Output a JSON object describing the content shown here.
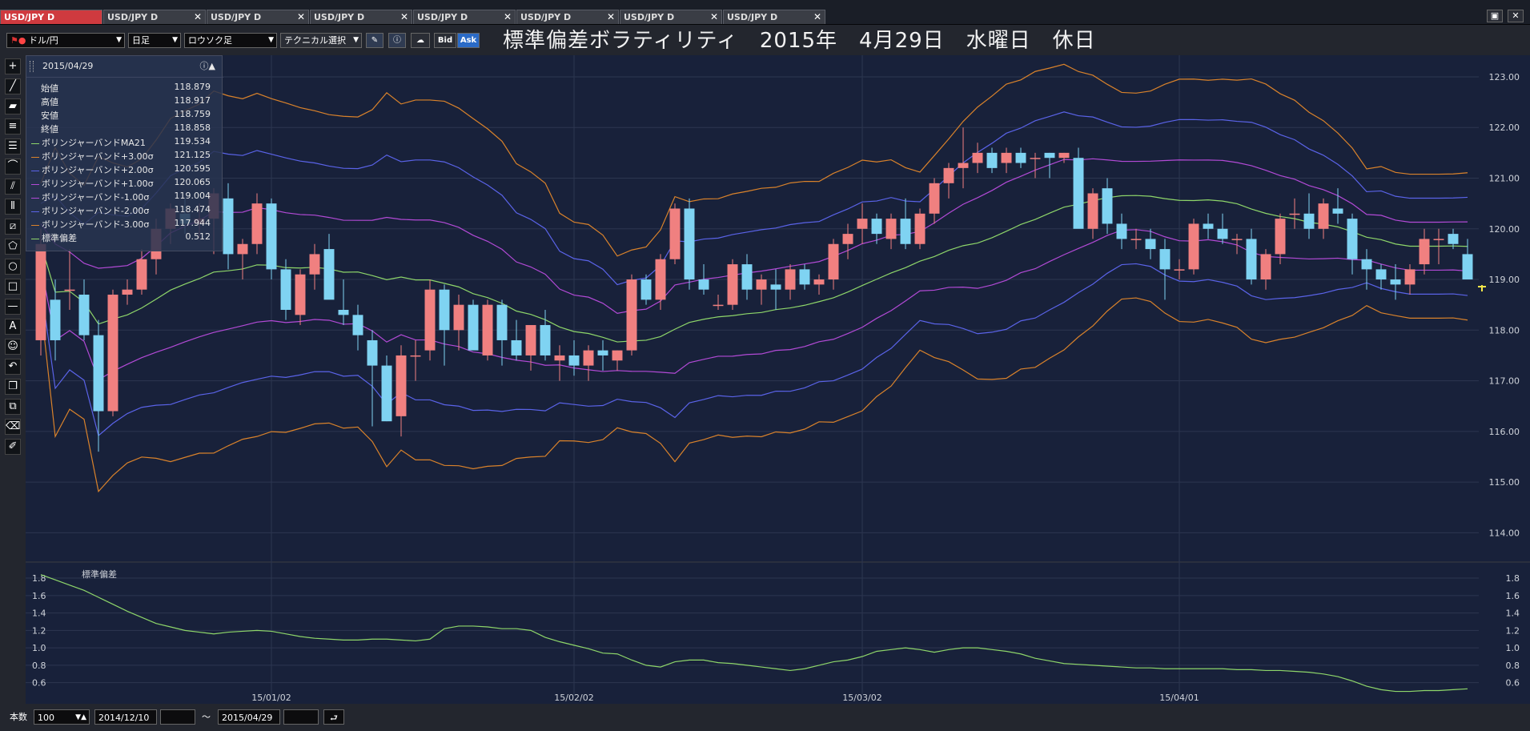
{
  "tabs": [
    {
      "label": "USD/JPY D",
      "active": true
    },
    {
      "label": "USD/JPY D",
      "active": false
    },
    {
      "label": "USD/JPY D",
      "active": false
    },
    {
      "label": "USD/JPY D",
      "active": false
    },
    {
      "label": "USD/JPY D",
      "active": false
    },
    {
      "label": "USD/JPY D",
      "active": false
    },
    {
      "label": "USD/JPY D",
      "active": false
    },
    {
      "label": "USD/JPY D",
      "active": false
    }
  ],
  "toolbar": {
    "currency": "ドル/円",
    "period": "日足",
    "chart_style": "ロウソク足",
    "technical": "テクニカル選択",
    "bid": "Bid",
    "ask": "Ask"
  },
  "title": "標準偏差ボラティリティ　2015年　4月29日　水曜日　休日",
  "info": {
    "date": "2015/04/29",
    "rows": [
      {
        "label": "始値",
        "value": "118.879"
      },
      {
        "label": "高値",
        "value": "118.917"
      },
      {
        "label": "安値",
        "value": "118.759"
      },
      {
        "label": "終値",
        "value": "118.858"
      },
      {
        "label": "ボリンジャーバンドMA21",
        "value": "119.534",
        "color": "#8ed66a"
      },
      {
        "label": "ボリンジャーバンド+3.00σ",
        "value": "121.125",
        "color": "#d9822b"
      },
      {
        "label": "ボリンジャーバンド+2.00σ",
        "value": "120.595",
        "color": "#5a63e8"
      },
      {
        "label": "ボリンジャーバンド+1.00σ",
        "value": "120.065",
        "color": "#b24ad6"
      },
      {
        "label": "ボリンジャーバンド-1.00σ",
        "value": "119.004",
        "color": "#b24ad6"
      },
      {
        "label": "ボリンジャーバンド-2.00σ",
        "value": "118.474",
        "color": "#5a63e8"
      },
      {
        "label": "ボリンジャーバンド-3.00σ",
        "value": "117.944",
        "color": "#d9822b"
      },
      {
        "label": "標準偏差",
        "value": "0.512",
        "color": "#8ed66a"
      }
    ]
  },
  "subpanel_label": "標準偏差",
  "status": {
    "count_label": "本数",
    "count_value": "100",
    "from_date": "2014/12/10",
    "tilde": "～",
    "to_date": "2015/04/29"
  },
  "colors": {
    "up": "#f08080",
    "down": "#7fd3f2",
    "ma": "#8ed66a",
    "s1": "#b24ad6",
    "s2": "#5a63e8",
    "s3": "#d9822b",
    "sd": "#8ed66a"
  },
  "chart_data": [
    {
      "type": "candlestick",
      "y_ticks": [
        "123.00",
        "122.00",
        "121.00",
        "120.00",
        "119.00",
        "118.00",
        "117.00",
        "116.00",
        "115.00",
        "114.00"
      ],
      "ylim": [
        113.5,
        123.3
      ],
      "x_ticks": [
        {
          "label": "15/01/02",
          "index": 16
        },
        {
          "label": "15/02/02",
          "index": 37
        },
        {
          "label": "15/03/02",
          "index": 57
        },
        {
          "label": "15/04/01",
          "index": 79
        }
      ],
      "n": 100,
      "candles": [
        [
          117.8,
          120.0,
          117.5,
          119.7
        ],
        [
          118.6,
          119.0,
          117.4,
          117.8
        ],
        [
          118.8,
          119.6,
          118.4,
          118.8
        ],
        [
          118.7,
          119.0,
          117.8,
          117.9
        ],
        [
          117.9,
          118.2,
          115.6,
          116.4
        ],
        [
          116.4,
          118.8,
          116.3,
          118.7
        ],
        [
          118.7,
          119.0,
          118.5,
          118.8
        ],
        [
          118.8,
          119.6,
          118.7,
          119.4
        ],
        [
          119.4,
          120.2,
          119.1,
          120.0
        ],
        [
          120.0,
          120.5,
          119.7,
          120.4
        ],
        [
          120.3,
          120.6,
          119.9,
          120.1
        ],
        [
          120.1,
          120.5,
          119.8,
          120.2
        ],
        [
          120.2,
          120.8,
          119.5,
          120.7
        ],
        [
          120.6,
          120.9,
          119.2,
          119.5
        ],
        [
          119.5,
          119.8,
          119.0,
          119.7
        ],
        [
          119.7,
          120.7,
          119.5,
          120.5
        ],
        [
          120.5,
          120.6,
          119.0,
          119.2
        ],
        [
          119.2,
          119.4,
          118.2,
          118.4
        ],
        [
          118.3,
          119.2,
          118.1,
          119.1
        ],
        [
          119.1,
          119.7,
          118.8,
          119.5
        ],
        [
          119.6,
          119.9,
          118.7,
          118.6
        ],
        [
          118.4,
          119.0,
          118.1,
          118.3
        ],
        [
          118.3,
          118.5,
          117.6,
          117.9
        ],
        [
          117.8,
          118.0,
          116.1,
          117.3
        ],
        [
          117.3,
          117.5,
          116.2,
          116.2
        ],
        [
          116.3,
          117.7,
          115.9,
          117.5
        ],
        [
          117.5,
          117.8,
          117.0,
          117.5
        ],
        [
          117.6,
          119.0,
          117.4,
          118.8
        ],
        [
          118.8,
          118.9,
          117.3,
          118.0
        ],
        [
          118.0,
          118.7,
          117.6,
          118.5
        ],
        [
          118.5,
          118.6,
          117.7,
          117.6
        ],
        [
          117.5,
          118.6,
          117.4,
          118.5
        ],
        [
          118.5,
          118.6,
          117.3,
          117.8
        ],
        [
          117.8,
          118.2,
          117.4,
          117.5
        ],
        [
          117.5,
          118.1,
          117.2,
          118.1
        ],
        [
          118.1,
          118.4,
          117.4,
          117.5
        ],
        [
          117.4,
          117.7,
          117.0,
          117.5
        ],
        [
          117.5,
          117.8,
          117.1,
          117.3
        ],
        [
          117.3,
          117.7,
          117.0,
          117.6
        ],
        [
          117.6,
          117.8,
          117.2,
          117.5
        ],
        [
          117.4,
          117.6,
          117.2,
          117.6
        ],
        [
          117.6,
          119.1,
          117.5,
          119.0
        ],
        [
          119.0,
          119.1,
          118.5,
          118.6
        ],
        [
          118.6,
          119.5,
          118.4,
          119.4
        ],
        [
          119.4,
          120.5,
          119.3,
          120.4
        ],
        [
          120.4,
          120.6,
          118.8,
          119.0
        ],
        [
          119.0,
          119.3,
          118.7,
          118.8
        ],
        [
          118.5,
          118.7,
          118.4,
          118.5
        ],
        [
          118.5,
          119.4,
          118.4,
          119.3
        ],
        [
          119.3,
          119.5,
          118.6,
          118.8
        ],
        [
          118.8,
          119.1,
          118.5,
          119.0
        ],
        [
          118.9,
          119.2,
          118.4,
          118.8
        ],
        [
          118.8,
          119.3,
          118.6,
          119.2
        ],
        [
          119.2,
          119.3,
          118.8,
          118.9
        ],
        [
          118.9,
          119.1,
          118.7,
          119.0
        ],
        [
          119.0,
          119.8,
          118.8,
          119.7
        ],
        [
          119.7,
          120.1,
          119.4,
          119.9
        ],
        [
          120.0,
          120.5,
          119.7,
          120.2
        ],
        [
          120.2,
          120.3,
          119.7,
          119.9
        ],
        [
          119.8,
          120.3,
          119.6,
          120.2
        ],
        [
          120.2,
          120.6,
          119.6,
          119.7
        ],
        [
          119.7,
          120.4,
          119.6,
          120.3
        ],
        [
          120.3,
          121.0,
          120.1,
          120.9
        ],
        [
          120.9,
          121.3,
          120.6,
          121.2
        ],
        [
          121.2,
          122.0,
          120.8,
          121.3
        ],
        [
          121.3,
          121.7,
          121.1,
          121.5
        ],
        [
          121.5,
          121.6,
          121.1,
          121.2
        ],
        [
          121.3,
          121.6,
          121.1,
          121.5
        ],
        [
          121.5,
          121.6,
          121.2,
          121.3
        ],
        [
          121.4,
          121.5,
          121.0,
          121.4
        ],
        [
          121.5,
          121.5,
          121.0,
          121.4
        ],
        [
          121.4,
          121.5,
          121.3,
          121.5
        ],
        [
          121.4,
          121.6,
          120.6,
          120.0
        ],
        [
          120.0,
          120.8,
          119.8,
          120.7
        ],
        [
          120.8,
          121.0,
          119.9,
          120.1
        ],
        [
          120.1,
          120.3,
          119.6,
          119.8
        ],
        [
          119.8,
          120.0,
          119.6,
          119.8
        ],
        [
          119.8,
          120.0,
          119.4,
          119.6
        ],
        [
          119.6,
          119.8,
          118.6,
          119.2
        ],
        [
          119.2,
          119.4,
          119.0,
          119.2
        ],
        [
          119.2,
          120.2,
          119.1,
          120.1
        ],
        [
          120.1,
          120.3,
          119.8,
          120.0
        ],
        [
          120.0,
          120.3,
          119.7,
          119.8
        ],
        [
          119.8,
          119.9,
          119.5,
          119.8
        ],
        [
          119.8,
          120.0,
          118.9,
          119.0
        ],
        [
          119.0,
          119.6,
          118.8,
          119.5
        ],
        [
          119.5,
          120.3,
          119.3,
          120.2
        ],
        [
          120.3,
          120.6,
          120.0,
          120.3
        ],
        [
          120.3,
          120.7,
          119.8,
          120.0
        ],
        [
          120.0,
          120.6,
          119.8,
          120.5
        ],
        [
          120.4,
          120.8,
          120.1,
          120.3
        ],
        [
          120.2,
          120.3,
          119.1,
          119.4
        ],
        [
          119.4,
          119.6,
          118.8,
          119.2
        ],
        [
          119.2,
          119.3,
          118.8,
          119.0
        ],
        [
          119.0,
          119.3,
          118.6,
          118.9
        ],
        [
          118.9,
          119.3,
          118.7,
          119.2
        ],
        [
          119.3,
          120.0,
          119.1,
          119.8
        ],
        [
          119.8,
          120.0,
          119.3,
          119.8
        ],
        [
          119.9,
          120.0,
          119.6,
          119.7
        ],
        [
          119.5,
          119.8,
          119.1,
          119.0
        ]
      ],
      "last_marker": 118.858
    },
    {
      "type": "line",
      "name": "標準偏差",
      "y_ticks": [
        "1.8",
        "1.6",
        "1.4",
        "1.2",
        "1.0",
        "0.8",
        "0.6"
      ],
      "ylim": [
        0.45,
        1.92
      ],
      "n": 100,
      "values": [
        1.84,
        1.78,
        1.72,
        1.66,
        1.58,
        1.5,
        1.42,
        1.35,
        1.28,
        1.24,
        1.2,
        1.18,
        1.16,
        1.18,
        1.19,
        1.2,
        1.19,
        1.16,
        1.13,
        1.11,
        1.1,
        1.09,
        1.09,
        1.1,
        1.1,
        1.09,
        1.08,
        1.1,
        1.22,
        1.25,
        1.25,
        1.24,
        1.22,
        1.22,
        1.2,
        1.12,
        1.07,
        1.03,
        0.99,
        0.94,
        0.93,
        0.86,
        0.8,
        0.78,
        0.84,
        0.86,
        0.86,
        0.83,
        0.82,
        0.8,
        0.78,
        0.76,
        0.74,
        0.76,
        0.8,
        0.84,
        0.86,
        0.9,
        0.96,
        0.98,
        1.0,
        0.98,
        0.95,
        0.98,
        1.0,
        1.0,
        0.98,
        0.96,
        0.93,
        0.88,
        0.85,
        0.82,
        0.81,
        0.8,
        0.79,
        0.78,
        0.77,
        0.77,
        0.76,
        0.76,
        0.76,
        0.76,
        0.76,
        0.75,
        0.75,
        0.74,
        0.74,
        0.73,
        0.72,
        0.7,
        0.67,
        0.62,
        0.56,
        0.52,
        0.5,
        0.5,
        0.51,
        0.51,
        0.52,
        0.53
      ]
    }
  ]
}
